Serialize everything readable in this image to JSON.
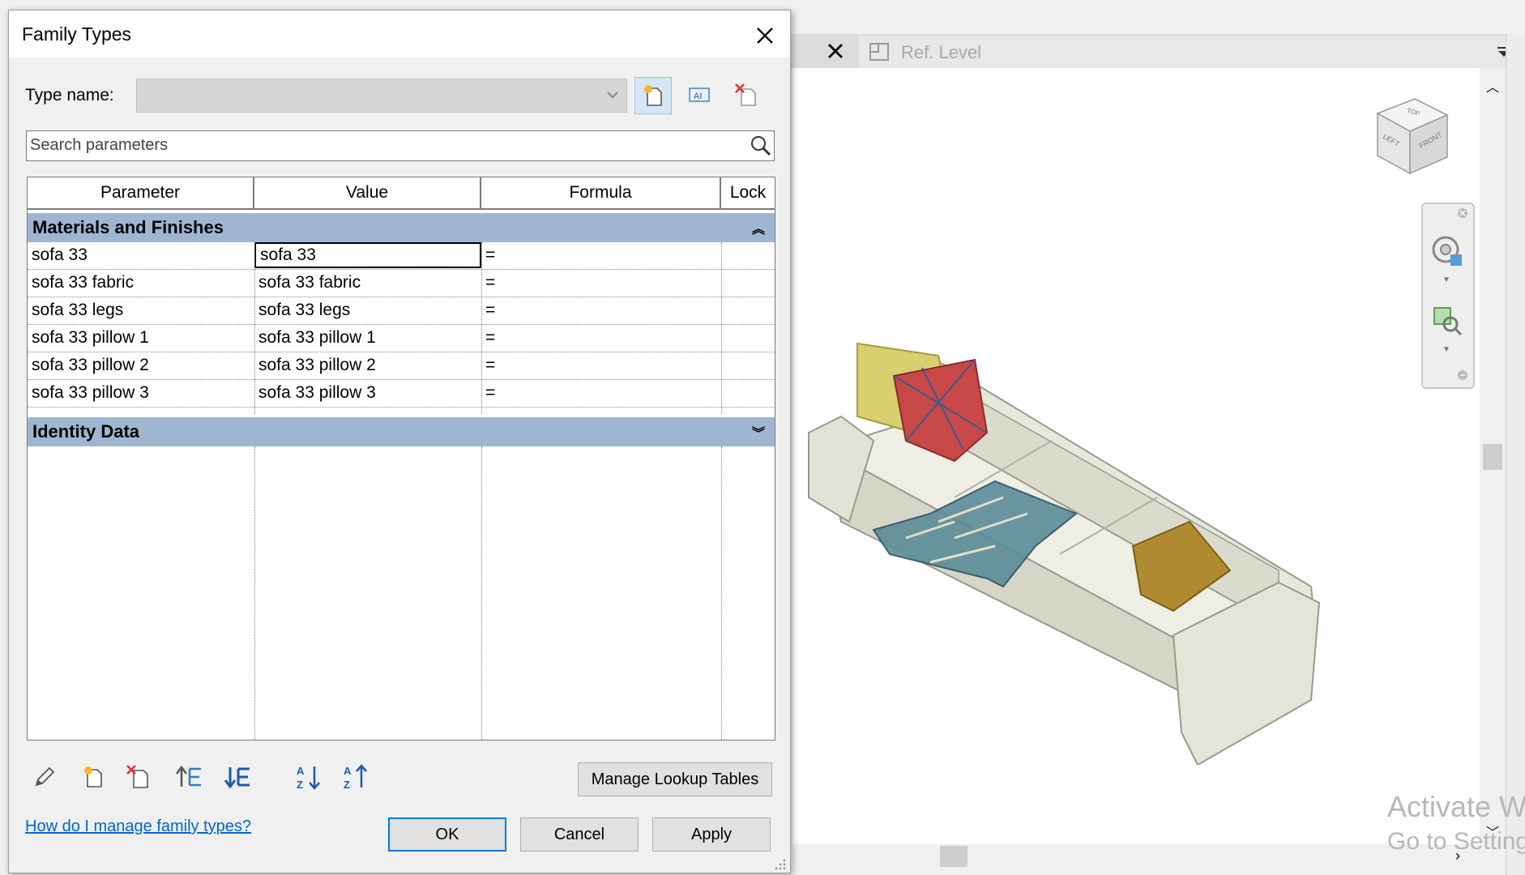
{
  "dialog": {
    "title": "Family Types",
    "type_name_label": "Type name:",
    "type_name_value": "",
    "search_placeholder": "Search parameters",
    "columns": [
      "Parameter",
      "Value",
      "Formula",
      "Lock"
    ],
    "groups": [
      {
        "label": "Materials and Finishes",
        "expanded": true,
        "rows": [
          {
            "parameter": "sofa 33",
            "value": "sofa 33",
            "formula": "="
          },
          {
            "parameter": "sofa 33 fabric",
            "value": "sofa 33 fabric",
            "formula": "="
          },
          {
            "parameter": "sofa 33 legs",
            "value": "sofa 33 legs",
            "formula": "="
          },
          {
            "parameter": "sofa 33 pillow 1",
            "value": "sofa 33 pillow 1",
            "formula": "="
          },
          {
            "parameter": "sofa 33 pillow 2",
            "value": "sofa 33 pillow 2",
            "formula": "="
          },
          {
            "parameter": "sofa 33 pillow 3",
            "value": "sofa 33 pillow 3",
            "formula": "="
          }
        ]
      },
      {
        "label": "Identity Data",
        "expanded": false,
        "rows": []
      }
    ],
    "manage_lookup_label": "Manage Lookup Tables",
    "help_link": "How do I manage family types?",
    "ok_label": "OK",
    "cancel_label": "Cancel",
    "apply_label": "Apply",
    "toolbar_icons": [
      "new-type-icon",
      "rename-type-icon",
      "delete-type-icon"
    ],
    "bottom_icons": [
      "edit-parameter-icon",
      "new-parameter-icon",
      "delete-parameter-icon",
      "move-up-icon",
      "move-down-icon",
      "sort-ascending-icon",
      "sort-descending-icon"
    ]
  },
  "view": {
    "tab_label": "Ref. Level",
    "viewcube_faces": [
      "TOP",
      "LEFT",
      "FRONT"
    ],
    "watermark_line1": "Activate W",
    "watermark_line2": "Go to Setting"
  },
  "colors": {
    "group_header": "#9fb6d2",
    "link": "#0066cc",
    "ok_border": "#0078d7"
  }
}
